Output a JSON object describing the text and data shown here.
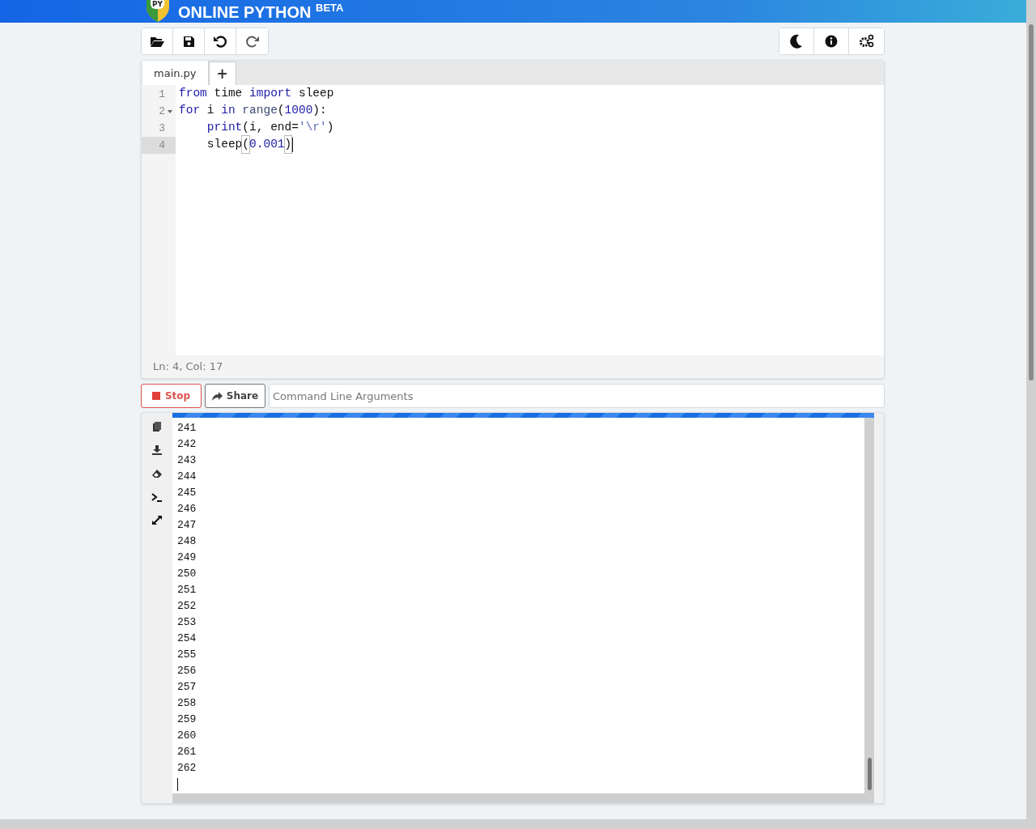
{
  "header": {
    "logo_text": "PY",
    "title": "ONLINE PYTHON $^{BETA}$"
  },
  "toolbar": {
    "left": [
      {
        "kind": "open"
      },
      {
        "kind": "save"
      },
      {
        "kind": "undo"
      },
      {
        "kind": "redo"
      }
    ],
    "right": [
      {
        "kind": "theme"
      },
      {
        "kind": "info"
      },
      {
        "kind": "settings"
      }
    ]
  },
  "tabs": [
    {
      "label": "main.py",
      "selected": true
    }
  ],
  "new_tab_label": "+",
  "code": [
    {
      "number": "1",
      "foldable": false,
      "active": false,
      "tokens": [
        {
          "text": "from",
          "kind": "keyword"
        },
        {
          "text": " time ",
          "kind": "plain"
        },
        {
          "text": "import",
          "kind": "keyword"
        },
        {
          "text": " sleep",
          "kind": "plain"
        }
      ]
    },
    {
      "number": "2",
      "foldable": true,
      "active": false,
      "tokens": [
        {
          "text": "for",
          "kind": "keyword"
        },
        {
          "text": " i ",
          "kind": "plain"
        },
        {
          "text": "in",
          "kind": "keyword"
        },
        {
          "text": " range",
          "kind": "builtin"
        },
        {
          "text": "(",
          "kind": "plain"
        },
        {
          "text": "1000",
          "kind": "number"
        },
        {
          "text": "):",
          "kind": "plain"
        }
      ]
    },
    {
      "number": "3",
      "foldable": false,
      "active": false,
      "tokens": [
        {
          "text": "    print",
          "kind": "keyword"
        },
        {
          "text": "(i, end=",
          "kind": "plain"
        },
        {
          "text": "'\\r'",
          "kind": "string"
        },
        {
          "text": ")",
          "kind": "plain"
        }
      ]
    },
    {
      "number": "4",
      "foldable": false,
      "active": true,
      "tokens": [
        {
          "text": "    sleep",
          "kind": "plain"
        },
        {
          "text": "(",
          "kind": "bracket"
        },
        {
          "text": "0.001",
          "kind": "number"
        },
        {
          "text": ")",
          "kind": "bracket"
        }
      ]
    }
  ],
  "status": "Ln: 4,  Col: 17",
  "run_bar": {
    "stop_label": "Stop",
    "share_label": "Share",
    "args_placeholder": "Command Line Arguments"
  },
  "output_tools": [
    {
      "kind": "copy"
    },
    {
      "kind": "download"
    },
    {
      "kind": "clear"
    },
    {
      "kind": "terminal"
    },
    {
      "kind": "expand"
    }
  ],
  "output": {
    "running": true,
    "lines": [
      "241",
      "242",
      "243",
      "244",
      "245",
      "246",
      "247",
      "248",
      "249",
      "250",
      "251",
      "252",
      "253",
      "254",
      "255",
      "256",
      "257",
      "258",
      "259",
      "260",
      "261",
      "262"
    ]
  }
}
